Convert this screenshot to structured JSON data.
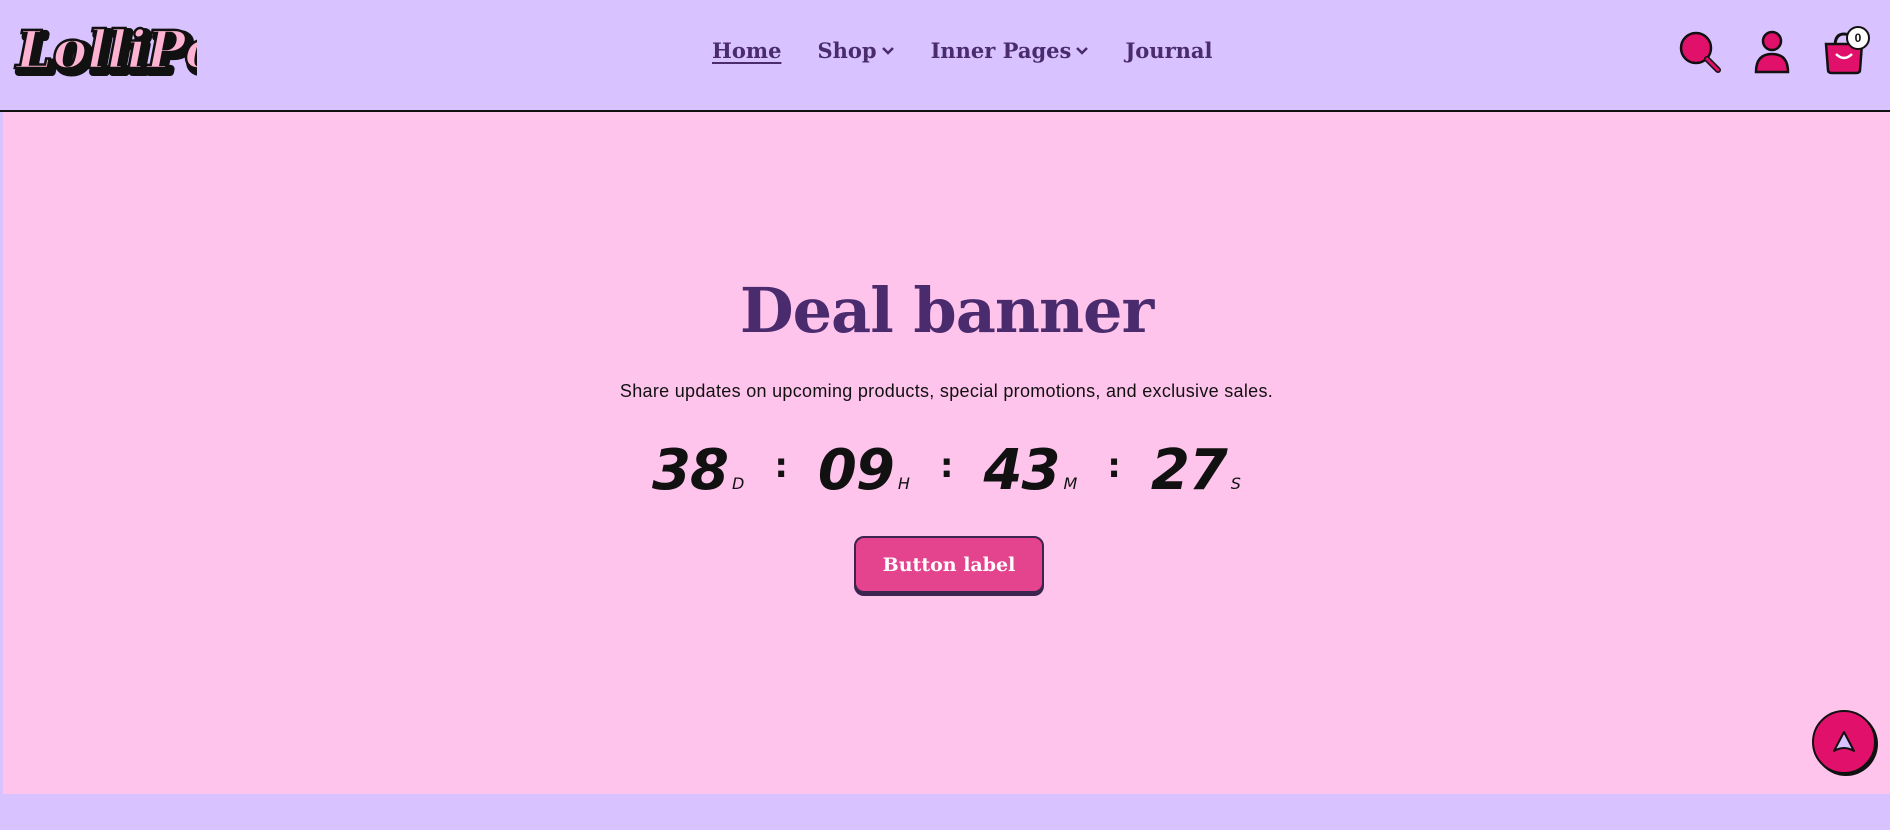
{
  "brand": {
    "logo_text": "LolliPop"
  },
  "nav": {
    "items": [
      {
        "label": "Home",
        "active": true,
        "dropdown": false
      },
      {
        "label": "Shop",
        "active": false,
        "dropdown": true
      },
      {
        "label": "Inner Pages",
        "active": false,
        "dropdown": true
      },
      {
        "label": "Journal",
        "active": false,
        "dropdown": false
      }
    ]
  },
  "header_icons": {
    "search": "search-icon",
    "account": "user-icon",
    "cart": "cart-icon",
    "cart_count": "0"
  },
  "hero": {
    "title": "Deal banner",
    "description": "Share updates on upcoming products, special promotions, and exclusive sales.",
    "countdown": {
      "days": "38",
      "days_label": "D",
      "hours": "09",
      "hours_label": "H",
      "minutes": "43",
      "minutes_label": "M",
      "seconds": "27",
      "seconds_label": "S",
      "separator": ":"
    },
    "button_label": "Button label"
  },
  "colors": {
    "header_bg": "#d8c2ff",
    "hero_bg": "#ffc4ec",
    "accent": "#e0106b",
    "title": "#4a2b6e",
    "button": "#e4438e"
  }
}
